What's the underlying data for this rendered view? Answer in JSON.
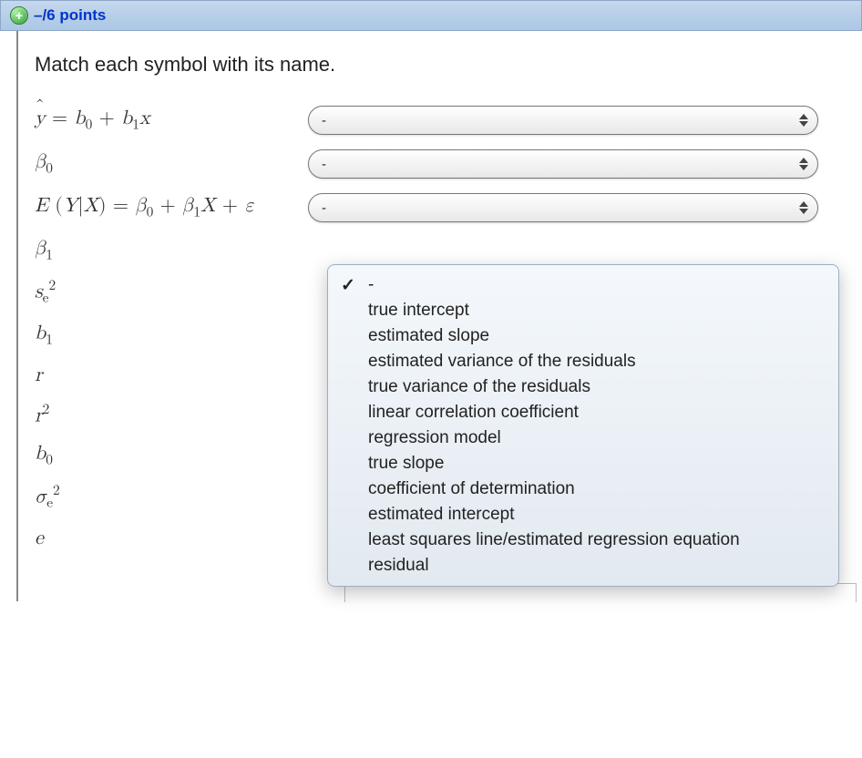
{
  "header": {
    "points_text": "–/6 points"
  },
  "question": {
    "prompt": "Match each symbol with its name."
  },
  "selects": {
    "placeholder": "-"
  },
  "dropdown": {
    "options": [
      "-",
      "true intercept",
      "estimated slope",
      "estimated variance of the residuals",
      "true variance of the residuals",
      "linear correlation coefficient",
      "regression model",
      "true slope",
      "coefficient of determination",
      "estimated intercept",
      "least squares line/estimated regression equation",
      "residual"
    ],
    "selected_index": 0
  },
  "symbols_plain": [
    "ŷ = b₀ + b₁x",
    "β₀",
    "E(Y|X) = β₀ + β₁X + ε",
    "β₁",
    "sₑ²",
    "b₁",
    "r",
    "r²",
    "b₀",
    "σₑ²",
    "e"
  ]
}
